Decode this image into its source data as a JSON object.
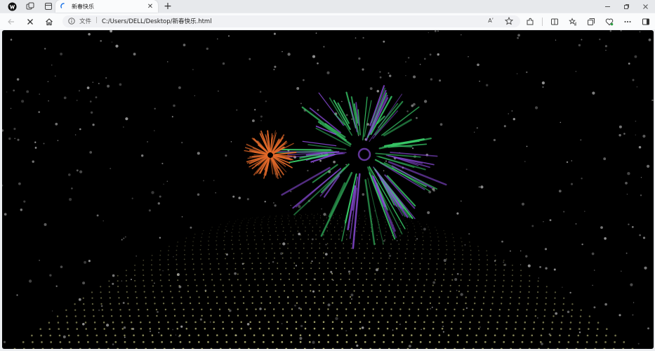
{
  "browser": {
    "tab": {
      "title": "新春快乐"
    },
    "address_bar": {
      "protocol_label": "文件",
      "separator": "|",
      "url": "C:/Users/DELL/Desktop/新春快乐.html",
      "read_aloud_label": "Aʹ"
    },
    "new_tab_symbol": "+",
    "close_tab_symbol": "✕"
  },
  "colors": {
    "page_background": "#000000",
    "firework_orange": "#e46a2a",
    "firework_green": "#3bd16c",
    "firework_purple": "#8a4bd8",
    "ground_dots": "#c9c884",
    "snow": "#9a9a9a",
    "accent_spinner": "#1b73e8"
  }
}
